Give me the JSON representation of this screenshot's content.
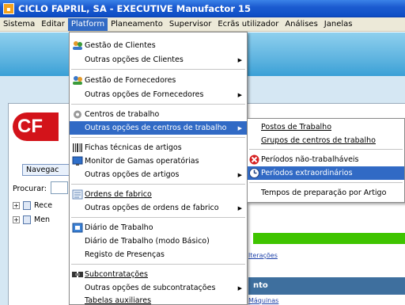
{
  "window": {
    "title": "CICLO FAPRIL, SA - EXECUTIVE Manufactor 15"
  },
  "menubar": [
    "Sistema",
    "Editar",
    "Platform",
    "Planeamento",
    "Supervisor",
    "Ecrãs utilizador",
    "Análises",
    "Janelas"
  ],
  "platform_menu": {
    "items": [
      "Gestão de Clientes",
      "Outras opções de Clientes",
      "Gestão de Fornecedores",
      "Outras opções de Fornecedores",
      "Centros de trabalho",
      "Outras opções de centros de trabalho",
      "Fichas técnicas de artigos",
      "Monitor de Gamas operatórias",
      "Outras opções de artigos",
      "Ordens de fabrico",
      "Outras opções de ordens de fabrico",
      "Diário de Trabalho",
      "Diário de Trabalho (modo Básico)",
      "Registo de Presenças",
      "Subcontratações",
      "Outras opções de subcontratações",
      "Tabelas auxiliares"
    ]
  },
  "submenu": {
    "items": [
      "Postos de Trabalho",
      "Grupos de centros de trabalho",
      "Períodos não-trabalháveis",
      "Períodos extraordinários",
      "Tempos de preparação por Artigo"
    ]
  },
  "background": {
    "logo": "CF",
    "tab_label": "Navegac",
    "search_label": "Procurar:",
    "tree": [
      "Rece",
      "Men"
    ],
    "link_alteracoes": "lterações",
    "header_partial": "nto",
    "link_maquinas": "Máquinas"
  },
  "colors": {
    "highlight": "#316ac5",
    "titlebar": "#0e4fc6",
    "menubar": "#ece9d8",
    "logo_red": "#d3131a",
    "green_bar": "#3fc400"
  }
}
